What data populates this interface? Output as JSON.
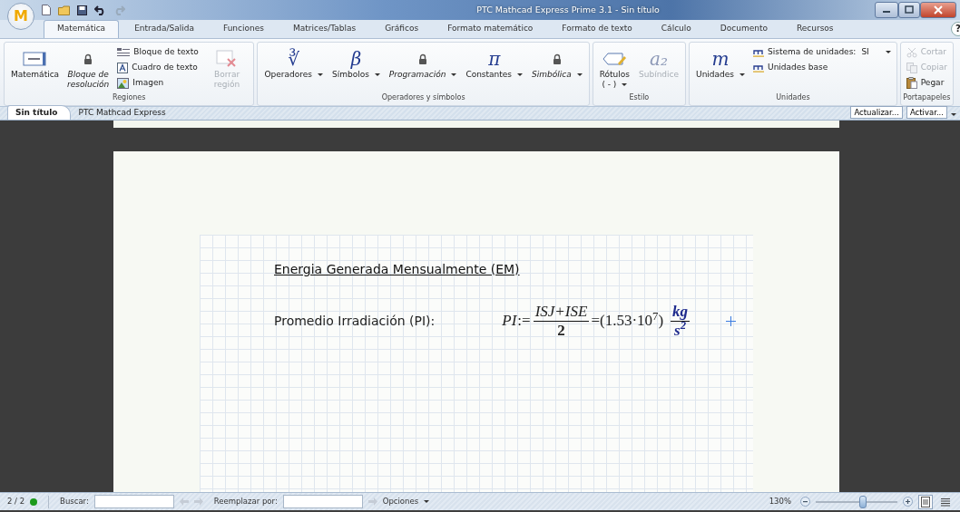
{
  "window": {
    "title": "PTC Mathcad Express Prime 3.1 - Sin título",
    "app_button": "M"
  },
  "tabs": [
    {
      "label": "Matemática",
      "selected": true
    },
    {
      "label": "Entrada/Salida",
      "selected": false
    },
    {
      "label": "Funciones",
      "selected": false
    },
    {
      "label": "Matrices/Tablas",
      "selected": false
    },
    {
      "label": "Gráficos",
      "selected": false
    },
    {
      "label": "Formato matemático",
      "selected": false
    },
    {
      "label": "Formato de texto",
      "selected": false
    },
    {
      "label": "Cálculo",
      "selected": false
    },
    {
      "label": "Documento",
      "selected": false
    },
    {
      "label": "Recursos",
      "selected": false
    }
  ],
  "help": "?",
  "ribbon": [
    {
      "title": "Regiones",
      "items": [
        {
          "kind": "big",
          "label": "Matemática",
          "locked": false,
          "disabled": false,
          "dropdown": false
        },
        {
          "kind": "big",
          "label": "Bloque de resolución",
          "locked": true,
          "disabled": false,
          "dropdown": false
        },
        {
          "kind": "stack",
          "entries": [
            {
              "label": "Bloque de texto",
              "disabled": false
            },
            {
              "label": "Cuadro de texto",
              "disabled": false
            },
            {
              "label": "Imagen",
              "disabled": false
            }
          ]
        },
        {
          "kind": "big",
          "label": "Borrar región",
          "locked": false,
          "disabled": true,
          "dropdown": false
        }
      ]
    },
    {
      "title": "Operadores y símbolos",
      "items": [
        {
          "kind": "big",
          "glyph": "∛",
          "label": "Operadores",
          "locked": false,
          "disabled": false,
          "dropdown": true
        },
        {
          "kind": "big",
          "glyph": "β",
          "label": "Símbolos",
          "locked": false,
          "disabled": false,
          "dropdown": true
        },
        {
          "kind": "big",
          "label": "Programación",
          "locked": true,
          "disabled": false,
          "dropdown": true
        },
        {
          "kind": "big",
          "glyph": "π",
          "label": "Constantes",
          "locked": false,
          "disabled": false,
          "dropdown": true
        },
        {
          "kind": "big",
          "label": "Simbólica",
          "locked": true,
          "disabled": false,
          "dropdown": true
        }
      ]
    },
    {
      "title": "Estilo",
      "items": [
        {
          "kind": "big",
          "label": "Rótulos",
          "sublabel": "( - )",
          "locked": false,
          "disabled": false,
          "dropdown": true
        },
        {
          "kind": "big",
          "glyph": "a₂",
          "label": "Subíndice",
          "locked": false,
          "disabled": true,
          "dropdown": false
        }
      ]
    },
    {
      "title": "Unidades",
      "items": [
        {
          "kind": "big",
          "glyph": "m",
          "label": "Unidades",
          "locked": false,
          "disabled": false,
          "dropdown": true
        },
        {
          "kind": "stack",
          "entries": [
            {
              "label": "Sistema de unidades:",
              "value": "SI",
              "disabled": false,
              "dropdown": true
            },
            {
              "label": "Unidades base",
              "disabled": false,
              "dropdown": false
            }
          ]
        }
      ]
    },
    {
      "title": "Portapapeles",
      "items": [
        {
          "kind": "stack",
          "entries": [
            {
              "label": "Cortar",
              "disabled": true
            },
            {
              "label": "Copiar",
              "disabled": true
            },
            {
              "label": "Pegar",
              "disabled": false
            }
          ]
        }
      ]
    }
  ],
  "doc_tabs": [
    {
      "label": "Sin título",
      "selected": true
    },
    {
      "label": "PTC Mathcad Express",
      "selected": false
    }
  ],
  "doc_actions": [
    "Actualizar...",
    "Activar..."
  ],
  "worksheet": {
    "heading": "Energia Generada Mensualmente (EM)",
    "label": "Promedio Irradiación (PI):",
    "formula": {
      "name": "PI",
      "assign": ":=",
      "numerator": "ISJ+ISE",
      "denominator": "2",
      "equals": "=",
      "result": "(1.53·10$^{7}$)",
      "unit_numerator": "kg",
      "unit_denominator": "s$^{2}$"
    }
  },
  "status_bar": {
    "pages": "2 / 2",
    "find_label": "Buscar:",
    "replace_label": "Reemplazar por:",
    "options": "Opciones",
    "zoom": "130%",
    "level": 0.58
  }
}
